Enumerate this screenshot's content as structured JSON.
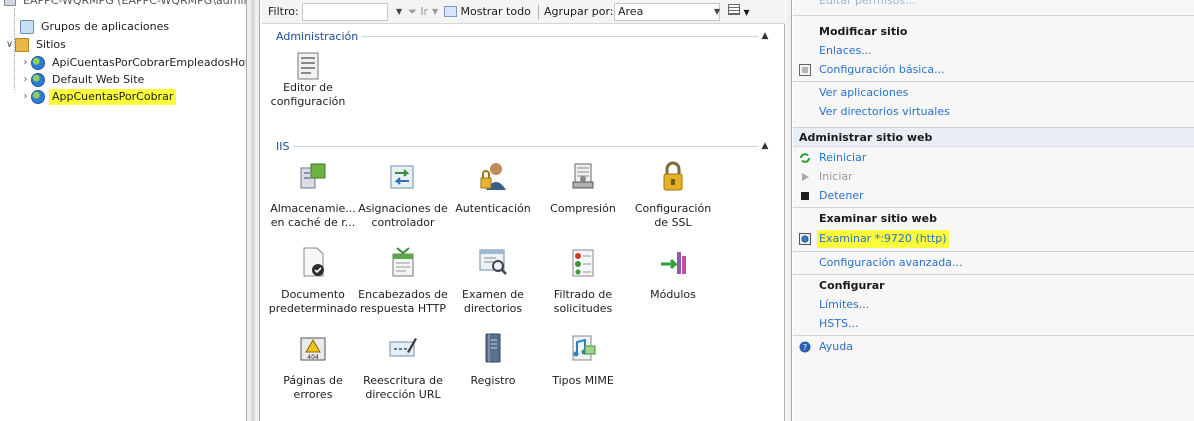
{
  "tree": {
    "truncated_top": "EAPPC-WQRMPG (EAPPC-WQRMPG\\admin",
    "app_pools": "Grupos de aplicaciones",
    "sites": "Sitios",
    "site_items": [
      {
        "label": "ApiCuentasPorCobrarEmpleadosHotel"
      },
      {
        "label": "Default Web Site"
      },
      {
        "label": "AppCuentasPorCobrar"
      }
    ]
  },
  "filterbar": {
    "filter_label": "Filtro:",
    "go": "Ir",
    "show_all": "Mostrar todo",
    "group_by": "Agrupar por:",
    "group_value": "Area"
  },
  "groups": {
    "admin": {
      "title": "Administración",
      "features": [
        {
          "label": "Editor de configuración",
          "icon": "config-editor-icon"
        }
      ]
    },
    "iis": {
      "title": "IIS",
      "features": [
        {
          "label": "Almacenamie... en caché de r...",
          "icon": "output-caching-icon"
        },
        {
          "label": "Asignaciones de controlador",
          "icon": "handler-mappings-icon"
        },
        {
          "label": "Autenticación",
          "icon": "authentication-icon"
        },
        {
          "label": "Compresión",
          "icon": "compression-icon"
        },
        {
          "label": "Configuración de SSL",
          "icon": "ssl-lock-icon"
        },
        {
          "label": "Documento predeterminado",
          "icon": "default-document-icon"
        },
        {
          "label": "Encabezados de respuesta HTTP",
          "icon": "http-headers-icon"
        },
        {
          "label": "Examen de directorios",
          "icon": "directory-browsing-icon"
        },
        {
          "label": "Filtrado de solicitudes",
          "icon": "request-filtering-icon"
        },
        {
          "label": "Módulos",
          "icon": "modules-icon"
        },
        {
          "label": "Páginas de errores",
          "icon": "error-pages-icon"
        },
        {
          "label": "Reescritura de dirección URL",
          "icon": "url-rewrite-icon"
        },
        {
          "label": "Registro",
          "icon": "logging-icon"
        },
        {
          "label": "Tipos MIME",
          "icon": "mime-types-icon"
        }
      ]
    }
  },
  "actions": {
    "truncated_top": "Editar permisos...",
    "modify_site": "Modificar sitio",
    "bindings": "Enlaces...",
    "basic_settings": "Configuración básica...",
    "view_apps": "Ver aplicaciones",
    "view_vdirs": "Ver directorios virtuales",
    "manage_site": "Administrar sitio web",
    "restart": "Reiniciar",
    "start": "Iniciar",
    "stop": "Detener",
    "browse_site": "Examinar sitio web",
    "browse_link": "Examinar *:9720 (http)",
    "advanced": "Configuración avanzada...",
    "configure": "Configurar",
    "limits": "Límites...",
    "hsts": "HSTS...",
    "help": "Ayuda"
  },
  "colors": {
    "highlight": "#fbfd3c",
    "link": "#2a71c9",
    "group_title": "#1f4e99"
  }
}
